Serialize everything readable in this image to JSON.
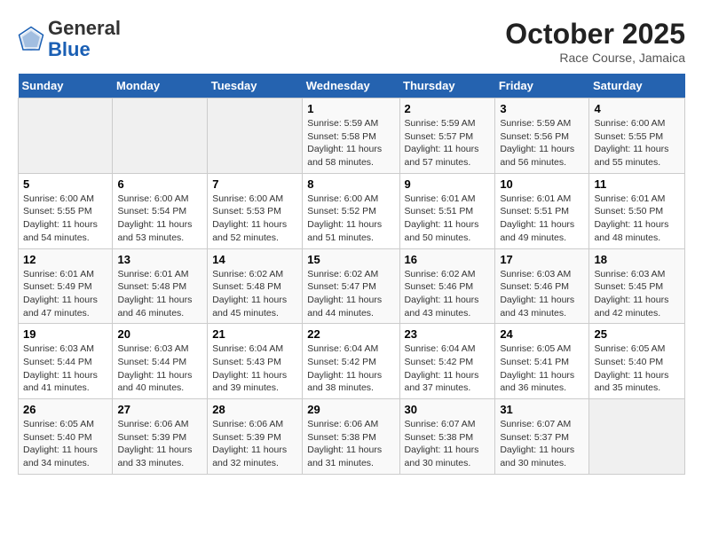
{
  "header": {
    "logo_general": "General",
    "logo_blue": "Blue",
    "month_title": "October 2025",
    "location": "Race Course, Jamaica"
  },
  "weekdays": [
    "Sunday",
    "Monday",
    "Tuesday",
    "Wednesday",
    "Thursday",
    "Friday",
    "Saturday"
  ],
  "weeks": [
    [
      {
        "day": "",
        "empty": true
      },
      {
        "day": "",
        "empty": true
      },
      {
        "day": "",
        "empty": true
      },
      {
        "day": "1",
        "sunrise": "5:59 AM",
        "sunset": "5:58 PM",
        "daylight": "11 hours and 58 minutes."
      },
      {
        "day": "2",
        "sunrise": "5:59 AM",
        "sunset": "5:57 PM",
        "daylight": "11 hours and 57 minutes."
      },
      {
        "day": "3",
        "sunrise": "5:59 AM",
        "sunset": "5:56 PM",
        "daylight": "11 hours and 56 minutes."
      },
      {
        "day": "4",
        "sunrise": "6:00 AM",
        "sunset": "5:55 PM",
        "daylight": "11 hours and 55 minutes."
      }
    ],
    [
      {
        "day": "5",
        "sunrise": "6:00 AM",
        "sunset": "5:55 PM",
        "daylight": "11 hours and 54 minutes."
      },
      {
        "day": "6",
        "sunrise": "6:00 AM",
        "sunset": "5:54 PM",
        "daylight": "11 hours and 53 minutes."
      },
      {
        "day": "7",
        "sunrise": "6:00 AM",
        "sunset": "5:53 PM",
        "daylight": "11 hours and 52 minutes."
      },
      {
        "day": "8",
        "sunrise": "6:00 AM",
        "sunset": "5:52 PM",
        "daylight": "11 hours and 51 minutes."
      },
      {
        "day": "9",
        "sunrise": "6:01 AM",
        "sunset": "5:51 PM",
        "daylight": "11 hours and 50 minutes."
      },
      {
        "day": "10",
        "sunrise": "6:01 AM",
        "sunset": "5:51 PM",
        "daylight": "11 hours and 49 minutes."
      },
      {
        "day": "11",
        "sunrise": "6:01 AM",
        "sunset": "5:50 PM",
        "daylight": "11 hours and 48 minutes."
      }
    ],
    [
      {
        "day": "12",
        "sunrise": "6:01 AM",
        "sunset": "5:49 PM",
        "daylight": "11 hours and 47 minutes."
      },
      {
        "day": "13",
        "sunrise": "6:01 AM",
        "sunset": "5:48 PM",
        "daylight": "11 hours and 46 minutes."
      },
      {
        "day": "14",
        "sunrise": "6:02 AM",
        "sunset": "5:48 PM",
        "daylight": "11 hours and 45 minutes."
      },
      {
        "day": "15",
        "sunrise": "6:02 AM",
        "sunset": "5:47 PM",
        "daylight": "11 hours and 44 minutes."
      },
      {
        "day": "16",
        "sunrise": "6:02 AM",
        "sunset": "5:46 PM",
        "daylight": "11 hours and 43 minutes."
      },
      {
        "day": "17",
        "sunrise": "6:03 AM",
        "sunset": "5:46 PM",
        "daylight": "11 hours and 43 minutes."
      },
      {
        "day": "18",
        "sunrise": "6:03 AM",
        "sunset": "5:45 PM",
        "daylight": "11 hours and 42 minutes."
      }
    ],
    [
      {
        "day": "19",
        "sunrise": "6:03 AM",
        "sunset": "5:44 PM",
        "daylight": "11 hours and 41 minutes."
      },
      {
        "day": "20",
        "sunrise": "6:03 AM",
        "sunset": "5:44 PM",
        "daylight": "11 hours and 40 minutes."
      },
      {
        "day": "21",
        "sunrise": "6:04 AM",
        "sunset": "5:43 PM",
        "daylight": "11 hours and 39 minutes."
      },
      {
        "day": "22",
        "sunrise": "6:04 AM",
        "sunset": "5:42 PM",
        "daylight": "11 hours and 38 minutes."
      },
      {
        "day": "23",
        "sunrise": "6:04 AM",
        "sunset": "5:42 PM",
        "daylight": "11 hours and 37 minutes."
      },
      {
        "day": "24",
        "sunrise": "6:05 AM",
        "sunset": "5:41 PM",
        "daylight": "11 hours and 36 minutes."
      },
      {
        "day": "25",
        "sunrise": "6:05 AM",
        "sunset": "5:40 PM",
        "daylight": "11 hours and 35 minutes."
      }
    ],
    [
      {
        "day": "26",
        "sunrise": "6:05 AM",
        "sunset": "5:40 PM",
        "daylight": "11 hours and 34 minutes."
      },
      {
        "day": "27",
        "sunrise": "6:06 AM",
        "sunset": "5:39 PM",
        "daylight": "11 hours and 33 minutes."
      },
      {
        "day": "28",
        "sunrise": "6:06 AM",
        "sunset": "5:39 PM",
        "daylight": "11 hours and 32 minutes."
      },
      {
        "day": "29",
        "sunrise": "6:06 AM",
        "sunset": "5:38 PM",
        "daylight": "11 hours and 31 minutes."
      },
      {
        "day": "30",
        "sunrise": "6:07 AM",
        "sunset": "5:38 PM",
        "daylight": "11 hours and 30 minutes."
      },
      {
        "day": "31",
        "sunrise": "6:07 AM",
        "sunset": "5:37 PM",
        "daylight": "11 hours and 30 minutes."
      },
      {
        "day": "",
        "empty": true
      }
    ]
  ]
}
